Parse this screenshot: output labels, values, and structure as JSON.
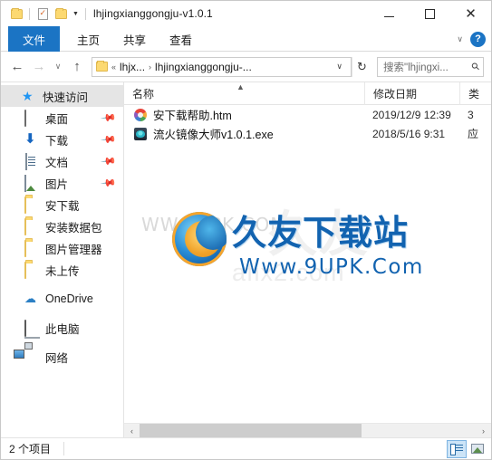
{
  "window": {
    "title": "lhjingxianggongju-v1.0.1",
    "quick_access_toolbar": [
      {
        "name": "folder-properties",
        "icon": "folder-icon"
      },
      {
        "name": "properties",
        "icon": "document-check-icon"
      },
      {
        "name": "new-folder",
        "icon": "folder-icon"
      },
      {
        "name": "customize",
        "icon": "chevron-down-icon"
      }
    ],
    "controls": {
      "minimize": "—",
      "maximize": "□",
      "close": "✕"
    }
  },
  "ribbon": {
    "tabs": [
      {
        "label": "文件",
        "active": true
      },
      {
        "label": "主页",
        "active": false
      },
      {
        "label": "共享",
        "active": false
      },
      {
        "label": "查看",
        "active": false
      }
    ],
    "expand_caret": "∨",
    "help_label": "?"
  },
  "address_bar": {
    "back": "←",
    "forward": "→",
    "history": "∨",
    "up": "↑",
    "overflow": "«",
    "crumb_separator": "›",
    "crumbs": [
      "lhjx...",
      "lhjingxianggongju-..."
    ],
    "dropdown": "∨",
    "refresh": "↻",
    "search_placeholder": "搜索\"lhjingxi...",
    "search_icon": "⚲"
  },
  "sidebar": {
    "items": [
      {
        "label": "快速访问",
        "icon": "star-pin-icon",
        "pinned": false,
        "selected": true
      },
      {
        "label": "桌面",
        "icon": "desktop-icon",
        "pinned": true
      },
      {
        "label": "下载",
        "icon": "downloads-icon",
        "pinned": true
      },
      {
        "label": "文档",
        "icon": "documents-icon",
        "pinned": true
      },
      {
        "label": "图片",
        "icon": "pictures-icon",
        "pinned": true
      },
      {
        "label": "安下载",
        "icon": "folder-icon",
        "pinned": false
      },
      {
        "label": "安装数据包",
        "icon": "folder-icon",
        "pinned": false
      },
      {
        "label": "图片管理器",
        "icon": "folder-icon",
        "pinned": false
      },
      {
        "label": "未上传",
        "icon": "folder-icon",
        "pinned": false
      },
      {
        "label": "OneDrive",
        "icon": "cloud-icon",
        "pinned": false
      },
      {
        "label": "此电脑",
        "icon": "this-pc-icon",
        "pinned": false
      },
      {
        "label": "网络",
        "icon": "network-icon",
        "pinned": false
      }
    ],
    "pin_glyph": "📌"
  },
  "file_list": {
    "columns": [
      {
        "label": "名称",
        "sorted": true,
        "sort_glyph": "▲"
      },
      {
        "label": "修改日期",
        "sorted": false
      },
      {
        "label": "类",
        "sorted": false
      }
    ],
    "rows": [
      {
        "name": "安下载帮助.htm",
        "modified": "2019/12/9 12:39",
        "type": "3",
        "icon": "html-file-icon"
      },
      {
        "name": "流火镜像大师v1.0.1.exe",
        "modified": "2018/5/16 9:31",
        "type": "应",
        "icon": "executable-file-icon"
      }
    ]
  },
  "watermark": {
    "chinese": "久友下载站",
    "url": "Www.9UPK.Com",
    "ghost_left": "WW.9UPK.COM",
    "ghost_big": "久友",
    "ghost_small": "afix2.com"
  },
  "scrollbar": {
    "left_arrow": "‹",
    "right_arrow": "›"
  },
  "status_bar": {
    "item_count": "2 个项目",
    "views": [
      {
        "name": "details-view",
        "active": true
      },
      {
        "name": "large-icons-view",
        "active": false
      }
    ]
  },
  "colors": {
    "accent": "#1b74c4",
    "selection": "#cce4f7",
    "folder": "#fcd971",
    "watermark_blue": "#1263b0"
  }
}
